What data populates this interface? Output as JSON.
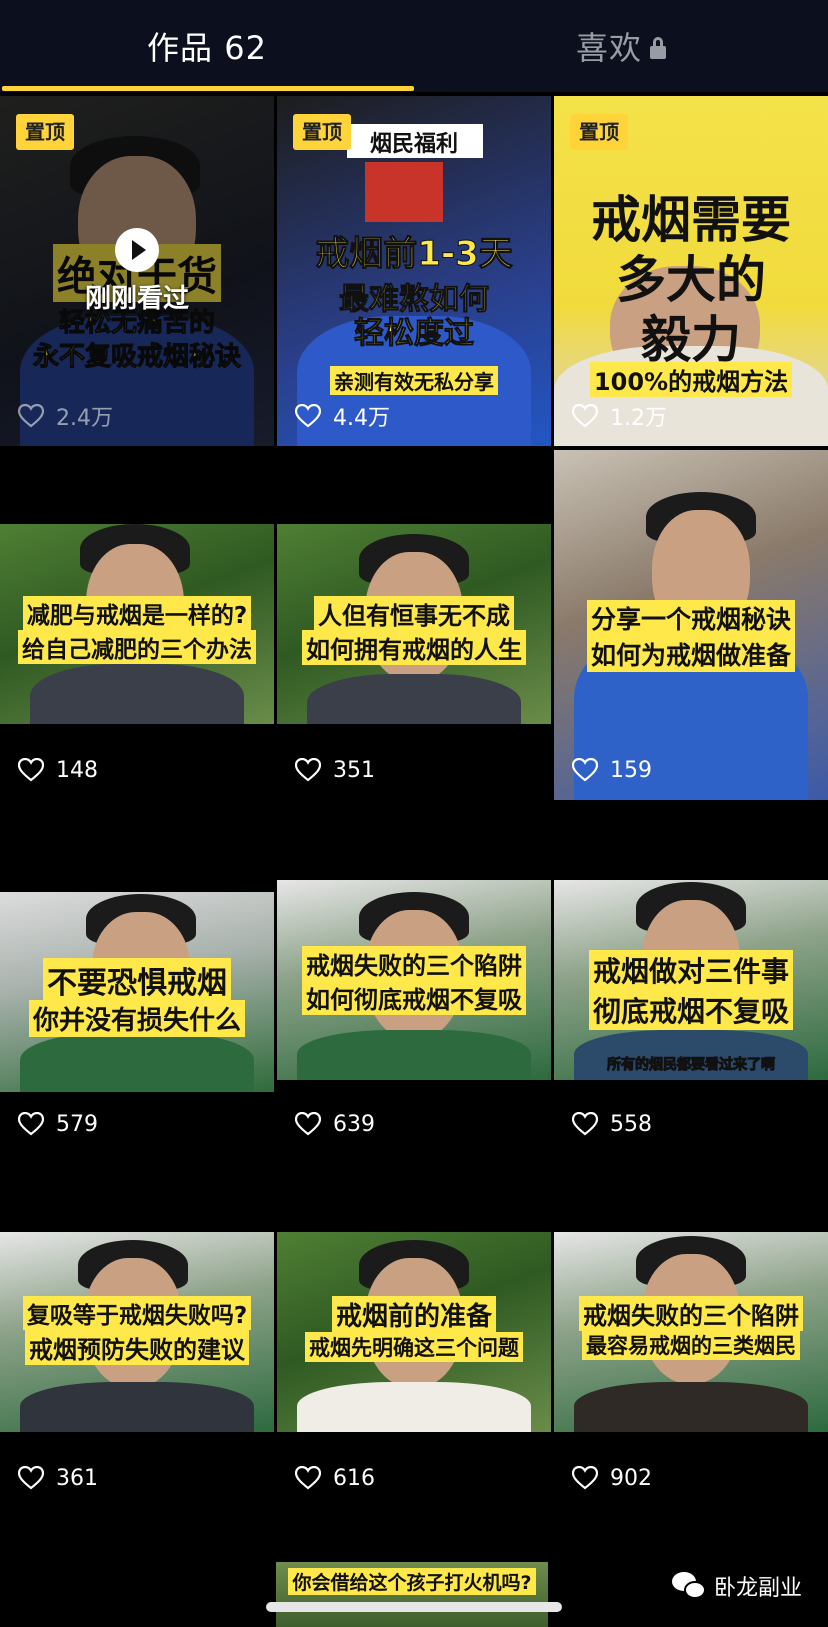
{
  "tabs": {
    "works_label": "作品 62",
    "likes_label": "喜欢",
    "likes_icon": "lock-icon",
    "active": "works"
  },
  "accent_color": "#ffd43b",
  "pin_label": "置顶",
  "videos": [
    {
      "pinned": true,
      "watched": true,
      "watched_label": "刚刚看过",
      "title_lines": [
        "绝对干货",
        "轻松无痛苦的",
        "永不复吸戒烟秘诀"
      ],
      "likes": "2.4万"
    },
    {
      "pinned": true,
      "top_banner": "烟民福利",
      "title_lines": [
        "戒烟前1-3天",
        "最难熬如何",
        "轻松度过"
      ],
      "subtitle": "亲测有效无私分享",
      "likes": "4.4万"
    },
    {
      "pinned": true,
      "title_lines": [
        "戒烟需要",
        "多大的",
        "毅力"
      ],
      "subtitle": "100%的戒烟方法",
      "likes": "1.2万"
    },
    {
      "title_lines": [
        "减肥与戒烟是一样的?",
        "给自己减肥的三个办法"
      ],
      "likes": "148"
    },
    {
      "title_lines": [
        "人但有恒事无不成",
        "如何拥有戒烟的人生"
      ],
      "likes": "351"
    },
    {
      "title_lines": [
        "分享一个戒烟秘诀",
        "如何为戒烟做准备"
      ],
      "likes": "159"
    },
    {
      "title_lines": [
        "不要恐惧戒烟",
        "你并没有损失什么"
      ],
      "likes": "579"
    },
    {
      "title_lines": [
        "戒烟失败的三个陷阱",
        "如何彻底戒烟不复吸"
      ],
      "likes": "639"
    },
    {
      "title_lines": [
        "戒烟做对三件事",
        "彻底戒烟不复吸"
      ],
      "bottom_text": "所有的烟民都要看过来了啊",
      "likes": "558"
    },
    {
      "title_lines": [
        "复吸等于戒烟失败吗?",
        "戒烟预防失败的建议"
      ],
      "likes": "361"
    },
    {
      "title_lines": [
        "戒烟前的准备",
        "戒烟先明确这三个问题"
      ],
      "likes": "616"
    },
    {
      "title_lines": [
        "戒烟失败的三个陷阱",
        "最容易戒烟的三类烟民"
      ],
      "likes": "902"
    }
  ],
  "partial_video_caption": "你会借给这个孩子打火机吗?",
  "watermark": {
    "icon": "wechat-icon",
    "text": "卧龙副业"
  },
  "icons": {
    "like": "heart-icon",
    "play": "play-icon"
  }
}
